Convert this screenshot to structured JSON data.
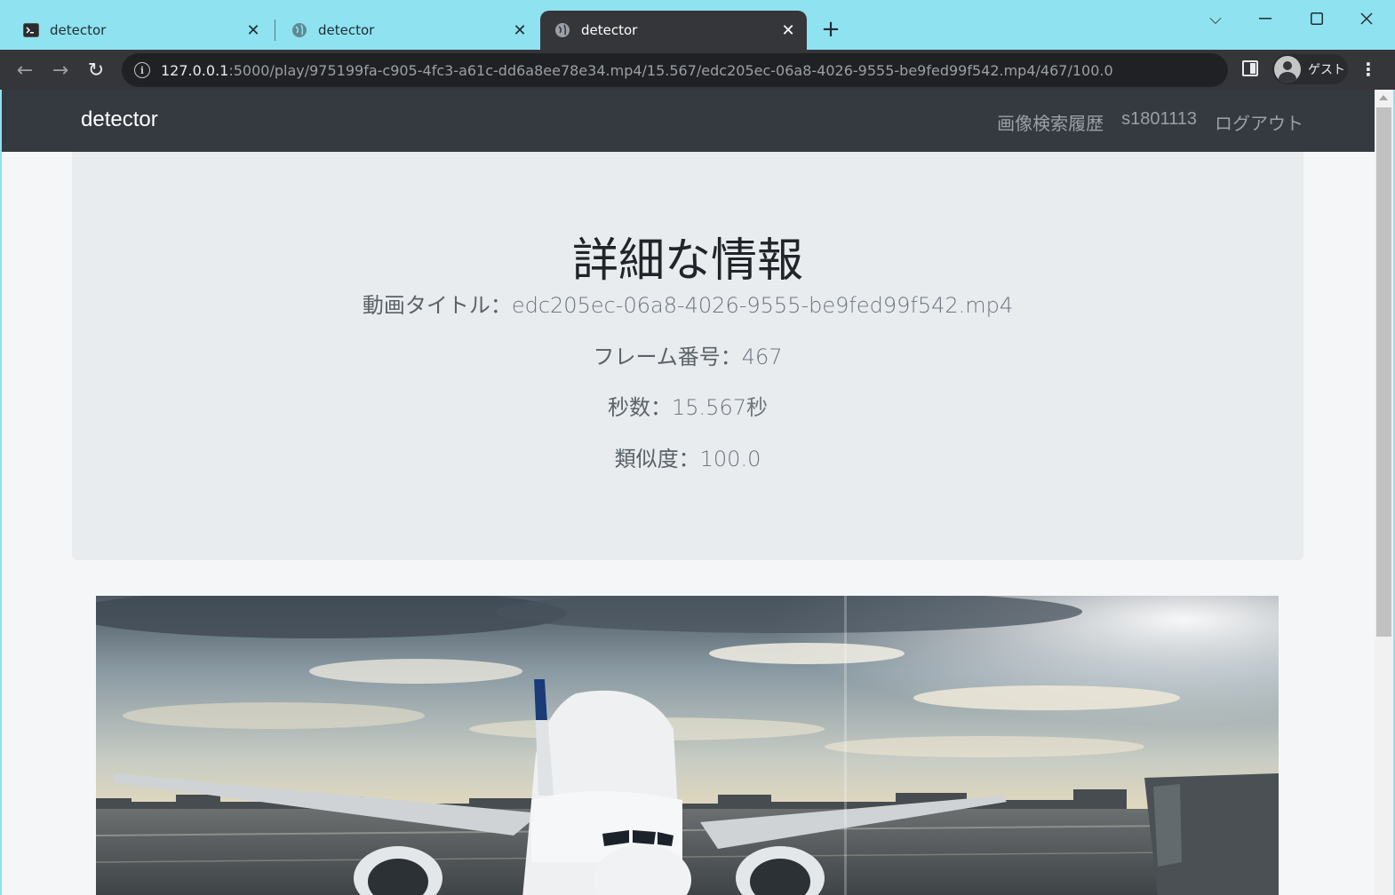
{
  "browser": {
    "tabs": [
      {
        "title": "detector",
        "icon": "terminal-icon",
        "active": false
      },
      {
        "title": "detector",
        "icon": "globe-icon",
        "active": false
      },
      {
        "title": "detector",
        "icon": "globe-icon",
        "active": true
      }
    ],
    "url_host": "127.0.0.1",
    "url_rest": ":5000/play/975199fa-c905-4fc3-a61c-dd6a8ee78e34.mp4/15.567/edc205ec-06a8-4026-9555-be9fed99f542.mp4/467/100.0",
    "profile_label": "ゲスト"
  },
  "navbar": {
    "brand": "detector",
    "links": [
      "画像検索履歴",
      "s1801113",
      "ログアウト"
    ]
  },
  "detail": {
    "heading": "詳細な情報",
    "video_title_label": "動画タイトル：",
    "video_title_value": "edc205ec-06a8-4026-9555-be9fed99f542.mp4",
    "frame_label": "フレーム番号：",
    "frame_value": "467",
    "seconds_label": "秒数：",
    "seconds_value": "15.567秒",
    "similarity_label": "類似度：",
    "similarity_value": "100.0"
  },
  "colors": {
    "tabstrip": "#8fe2f0",
    "toolbar": "#35363a",
    "navbar": "#343a40",
    "jumbotron": "#e9ecef"
  }
}
